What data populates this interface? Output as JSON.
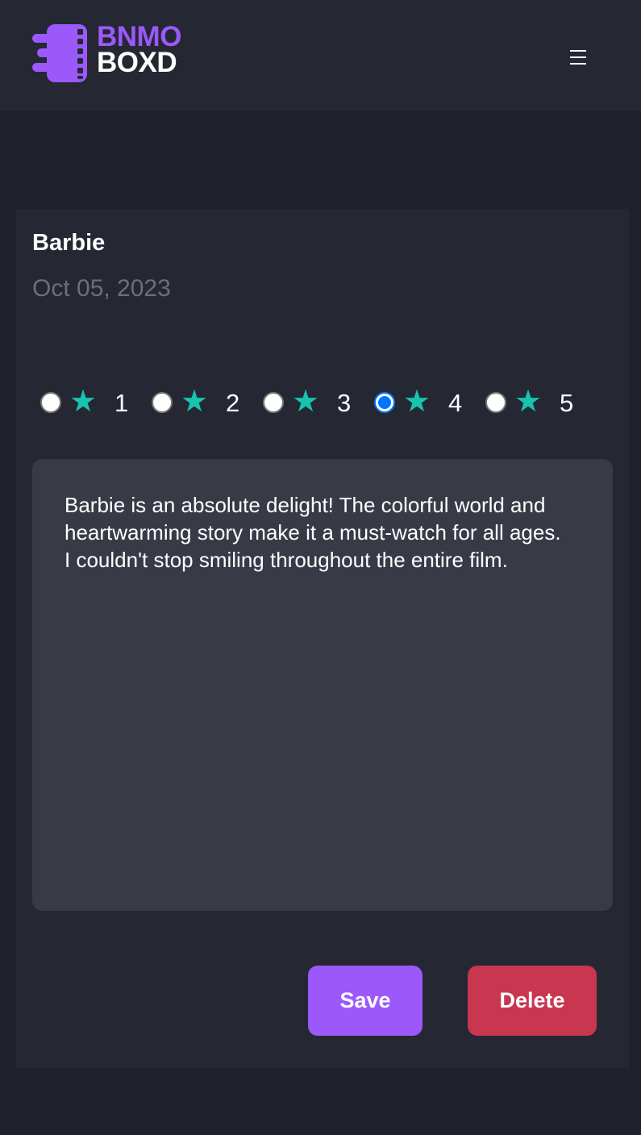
{
  "header": {
    "logo": {
      "line1": "BNMO",
      "line2": "BOXD",
      "icon": "film-strip-icon"
    },
    "menu_icon": "hamburger-menu-icon"
  },
  "colors": {
    "background": "#1f2029",
    "card": "#252733",
    "accent_purple": "#9b59fb",
    "star_teal": "#17c4b0",
    "delete_red": "#c9364f",
    "textarea": "#383b46",
    "muted_text": "#6c6f7a",
    "radio_checked": "#0075ff"
  },
  "review": {
    "title": "Barbie",
    "date": "Oct 05, 2023",
    "rating": {
      "options": [
        "1",
        "2",
        "3",
        "4",
        "5"
      ],
      "selected": "4",
      "star_icon": "star-icon"
    },
    "text": "Barbie is an absolute delight! The colorful world and heartwarming story make it a must-watch for all ages. I couldn't stop smiling throughout the entire film."
  },
  "actions": {
    "save_label": "Save",
    "delete_label": "Delete"
  }
}
